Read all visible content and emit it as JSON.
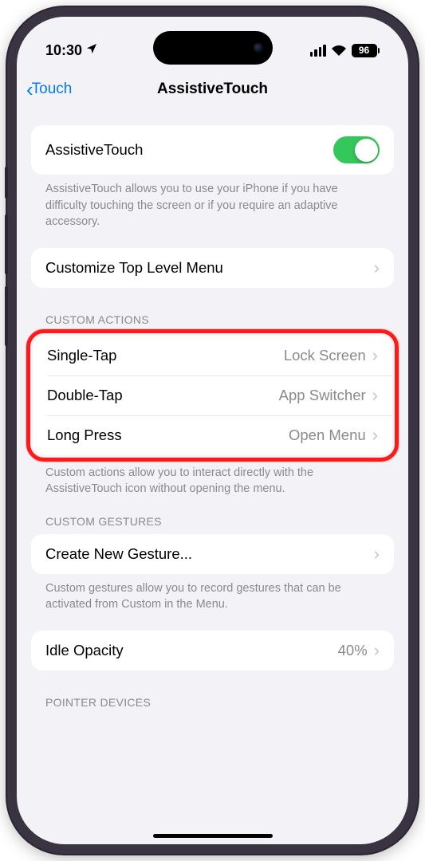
{
  "status": {
    "time": "10:30",
    "battery_pct": "96"
  },
  "nav": {
    "back_label": "Touch",
    "title": "AssistiveTouch"
  },
  "main_toggle": {
    "label": "AssistiveTouch",
    "description": "AssistiveTouch allows you to use your iPhone if you have difficulty touching the screen or if you require an adaptive accessory."
  },
  "customize_menu": {
    "label": "Customize Top Level Menu"
  },
  "custom_actions": {
    "header": "CUSTOM ACTIONS",
    "rows": [
      {
        "label": "Single-Tap",
        "value": "Lock Screen"
      },
      {
        "label": "Double-Tap",
        "value": "App Switcher"
      },
      {
        "label": "Long Press",
        "value": "Open Menu"
      }
    ],
    "footer": "Custom actions allow you to interact directly with the AssistiveTouch icon without opening the menu."
  },
  "custom_gestures": {
    "header": "CUSTOM GESTURES",
    "label": "Create New Gesture...",
    "footer": "Custom gestures allow you to record gestures that can be activated from Custom in the Menu."
  },
  "idle_opacity": {
    "label": "Idle Opacity",
    "value": "40%"
  },
  "pointer_devices": {
    "header": "POINTER DEVICES"
  }
}
